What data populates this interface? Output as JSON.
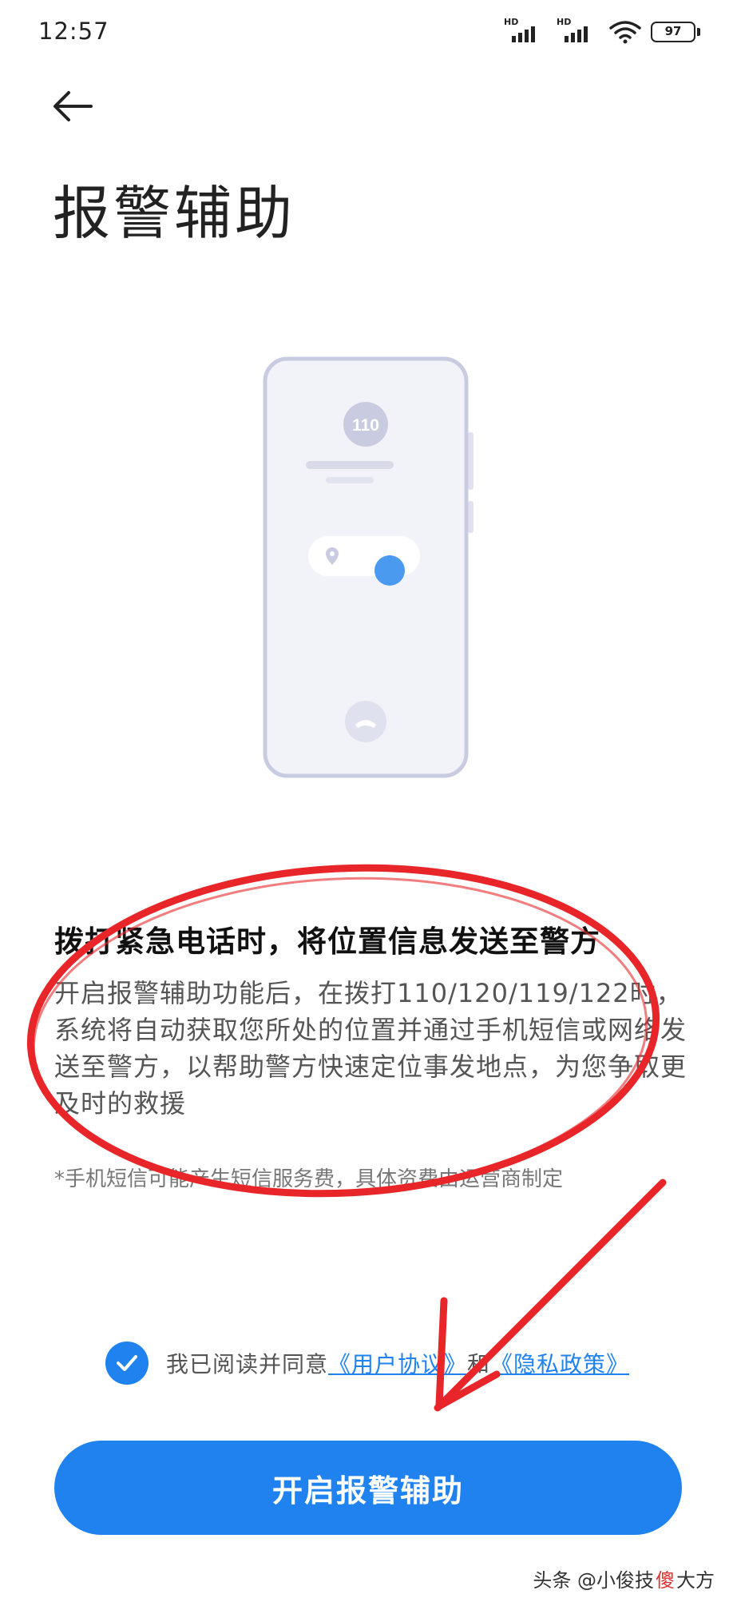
{
  "status_bar": {
    "time": "12:57",
    "signal_1_label": "HD",
    "signal_2_label": "HD",
    "battery": "97",
    "icons": [
      "hd-signal-icon",
      "hd-signal-icon",
      "wifi-icon",
      "battery-icon"
    ]
  },
  "page": {
    "title": "报警辅助",
    "back_icon": "arrow-left-icon"
  },
  "illustration": {
    "dial_number": "110",
    "icons": [
      "phone-illustration",
      "location-pin-icon",
      "hang-up-icon"
    ]
  },
  "content": {
    "headline": "拨打紧急电话时，将位置信息发送至警方",
    "description": "开启报警辅助功能后，在拨打110/120/119/122时，系统将自动获取您所处的位置并通过手机短信或网络发送至警方，以帮助警方快速定位事发地点，为您争取更及时的救援",
    "note": "*手机短信可能产生短信服务费，具体资费由运营商制定"
  },
  "agreement": {
    "checked": true,
    "prefix": "我已阅读并同意",
    "user_agreement": "《用户协议》",
    "conjunction": "和",
    "privacy_policy": "《隐私政策》"
  },
  "primary_button": {
    "label": "开启报警辅助"
  },
  "watermark": {
    "prefix": "头条 @小俊技",
    "highlight": "傻",
    "suffix": "大方"
  },
  "colors": {
    "accent": "#1f82ef",
    "annotation": "#e8262a",
    "illustration_outline": "#c9cce0",
    "illustration_fill": "#f2f3f9",
    "toggle_dot": "#4a9af0"
  }
}
